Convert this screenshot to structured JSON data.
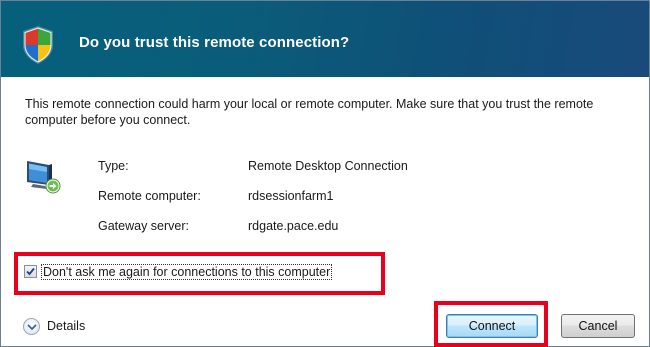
{
  "dialog": {
    "title": "Do you trust this remote connection?",
    "message": "This remote connection could harm your local or remote computer. Make sure that you trust the remote computer before you connect."
  },
  "details": {
    "rows": [
      {
        "label": "Type:",
        "value": "Remote Desktop Connection"
      },
      {
        "label": "Remote computer:",
        "value": "rdsessionfarm1"
      },
      {
        "label": "Gateway server:",
        "value": "rdgate.pace.edu"
      }
    ]
  },
  "checkbox": {
    "label": "Don't ask me again for connections to this computer",
    "checked": true
  },
  "footer": {
    "details_label": "Details",
    "connect_label": "Connect",
    "cancel_label": "Cancel"
  },
  "colors": {
    "title_bar": "#0a5d7a",
    "highlight": "#e8001c",
    "connect_button": "#bee6fd"
  },
  "icons": {
    "title": "uac-shield-icon",
    "connection": "remote-computer-icon",
    "details": "chevron-down-icon"
  }
}
